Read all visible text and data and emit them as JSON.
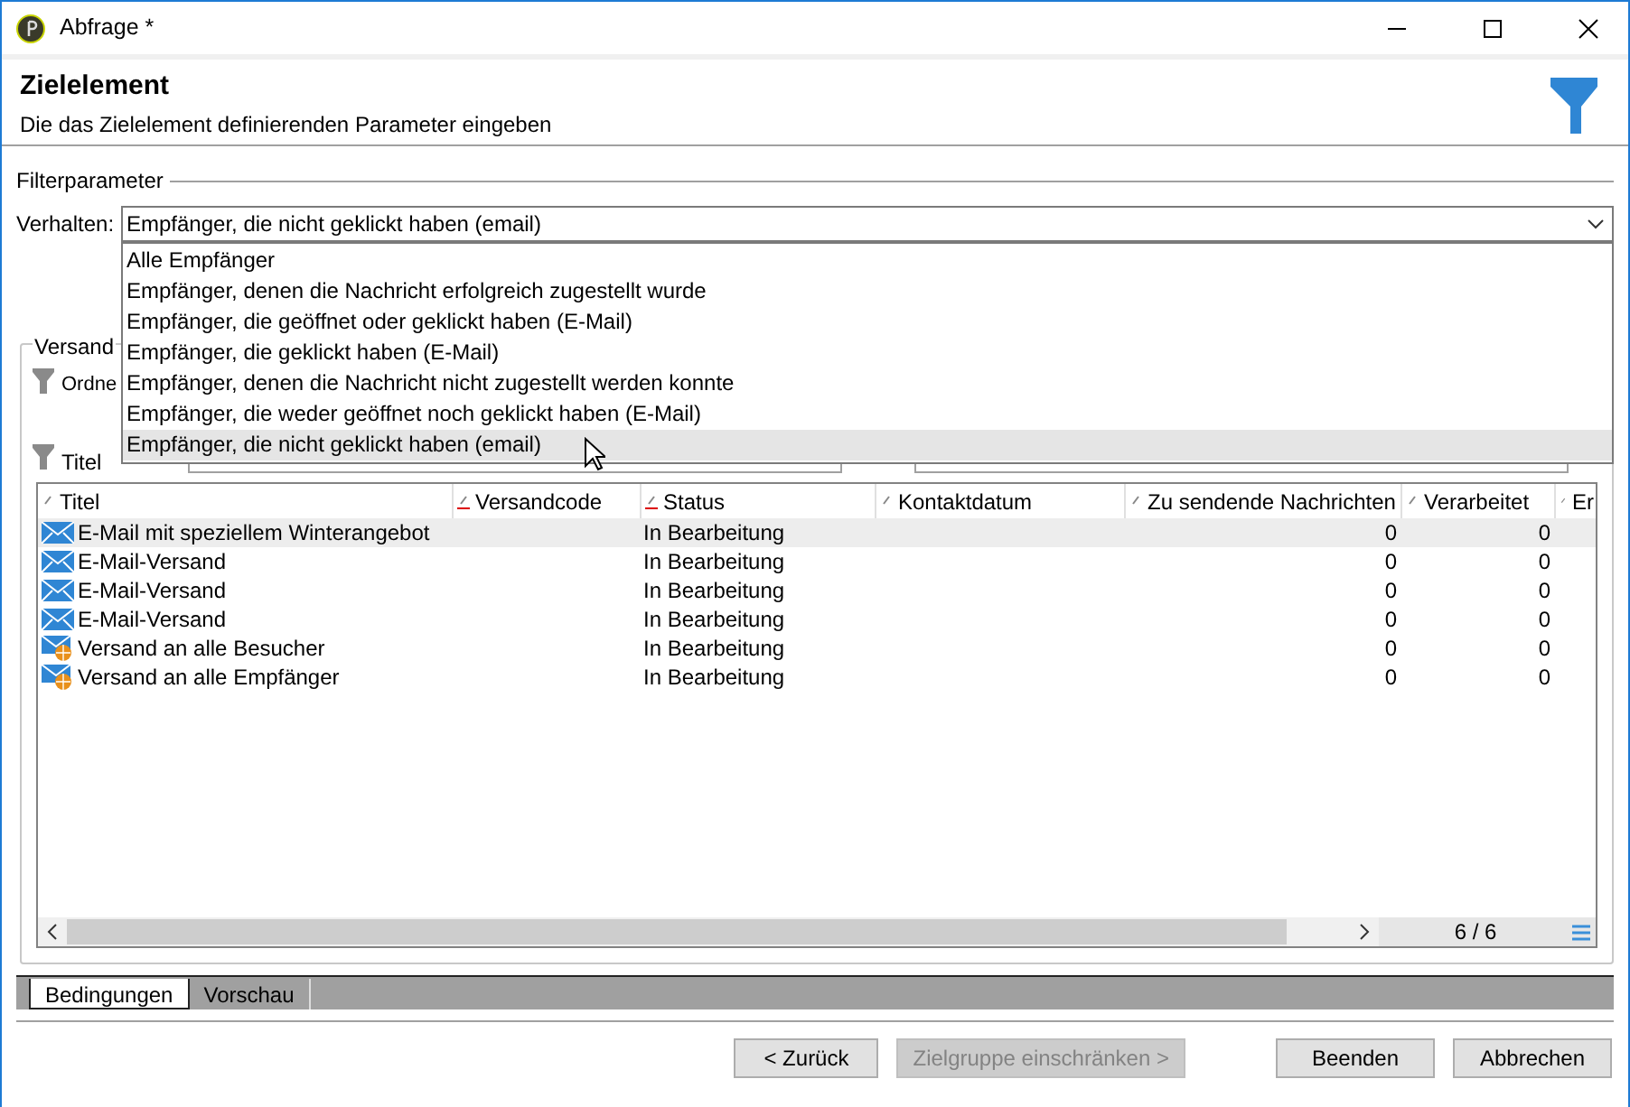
{
  "window": {
    "title": "Abfrage *"
  },
  "header": {
    "title": "Zielelement",
    "subtitle": "Die das Zielelement definierenden Parameter eingeben"
  },
  "filter_group": {
    "legend": "Filterparameter",
    "behavior_label": "Verhalten:",
    "behavior_value": "Empfänger, die nicht geklickt haben (email)",
    "expanded": true,
    "options": [
      {
        "label": "Alle Empfänger",
        "selected": false
      },
      {
        "label": "Empfänger, denen die Nachricht erfolgreich zugestellt wurde",
        "selected": false
      },
      {
        "label": "Empfänger, die geöffnet oder geklickt haben (E-Mail)",
        "selected": false
      },
      {
        "label": "Empfänger, die geklickt haben (E-Mail)",
        "selected": false
      },
      {
        "label": "Empfänger, denen die Nachricht nicht zugestellt werden konnte",
        "selected": false
      },
      {
        "label": "Empfänger, die weder geöffnet noch geklickt haben (E-Mail)",
        "selected": false
      },
      {
        "label": "Empfänger, die nicht geklickt haben (email)",
        "selected": true
      }
    ]
  },
  "delivery_group": {
    "legend": "Versand",
    "filter_labels": [
      "Ordne",
      "Titel"
    ],
    "table": {
      "columns": [
        {
          "label": "Titel",
          "sorted": false
        },
        {
          "label": "Versandcode",
          "sorted": true
        },
        {
          "label": "Status",
          "sorted": true
        },
        {
          "label": "Kontaktdatum",
          "sorted": false
        },
        {
          "label": "Zu sendende Nachrichten",
          "sorted": false
        },
        {
          "label": "Verarbeitet",
          "sorted": false
        },
        {
          "label": "Er",
          "sorted": false
        }
      ],
      "rows": [
        {
          "kind": "email",
          "title": "E-Mail mit speziellem Winterangebot",
          "status": "In Bearbeitung",
          "to_send": "0",
          "processed": "0",
          "selected": true
        },
        {
          "kind": "email",
          "title": "E-Mail-Versand",
          "status": "In Bearbeitung",
          "to_send": "0",
          "processed": "0",
          "selected": false
        },
        {
          "kind": "email",
          "title": "E-Mail-Versand",
          "status": "In Bearbeitung",
          "to_send": "0",
          "processed": "0",
          "selected": false
        },
        {
          "kind": "email",
          "title": "E-Mail-Versand",
          "status": "In Bearbeitung",
          "to_send": "0",
          "processed": "0",
          "selected": false
        },
        {
          "kind": "web",
          "title": "Versand an alle Besucher",
          "status": "In Bearbeitung",
          "to_send": "0",
          "processed": "0",
          "selected": false
        },
        {
          "kind": "web",
          "title": "Versand an alle Empfänger",
          "status": "In Bearbeitung",
          "to_send": "0",
          "processed": "0",
          "selected": false
        }
      ],
      "pager": "6 / 6"
    }
  },
  "tabs": [
    {
      "label": "Bedingungen",
      "selected": true
    },
    {
      "label": "Vorschau",
      "selected": false
    }
  ],
  "buttons": [
    {
      "label": "< Zurück",
      "disabled": false
    },
    {
      "label": "Zielgruppe einschränken >",
      "disabled": true
    },
    {
      "label": "Beenden",
      "disabled": false
    },
    {
      "label": "Abbrechen",
      "disabled": false
    }
  ]
}
